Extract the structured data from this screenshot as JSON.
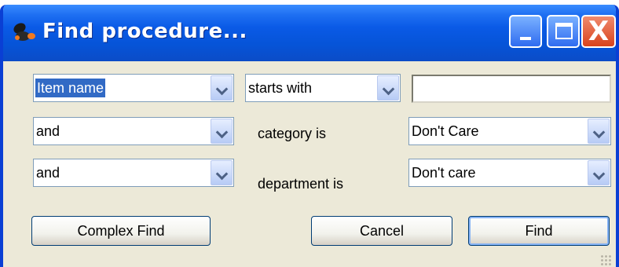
{
  "window": {
    "title": "Find procedure...",
    "title_icon": "pills-icon"
  },
  "titlebar_buttons": {
    "minimize": "minimize-icon",
    "maximize": "maximize-icon",
    "close": "close-icon",
    "close_glyph": "X"
  },
  "row1": {
    "field_value": "Item name",
    "operator_value": "starts with",
    "search_text": ""
  },
  "row2": {
    "connector_value": "and",
    "label": "category is",
    "category_value": "Don't Care"
  },
  "row3": {
    "connector_value": "and",
    "label": "department is",
    "department_value": "Don't care"
  },
  "buttons": {
    "complex_find": "Complex Find",
    "cancel": "Cancel",
    "find": "Find"
  },
  "colors": {
    "titlebar": "#0654d8",
    "dialog_bg": "#ece9d8",
    "selection": "#316ac5",
    "close_button": "#d8431c"
  }
}
